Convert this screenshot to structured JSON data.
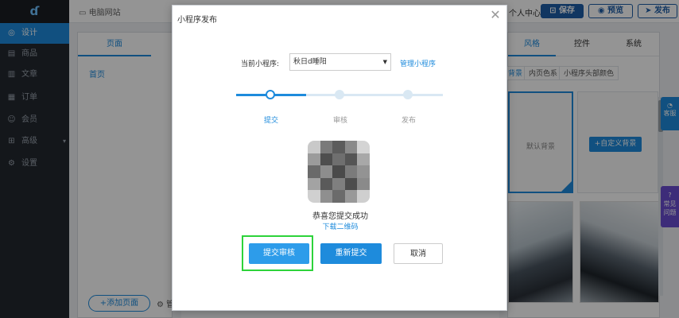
{
  "sidebar": {
    "logo": "ɗ",
    "items": [
      {
        "icon": "palette-icon",
        "glyph": "◎",
        "label": "设计",
        "active": true
      },
      {
        "icon": "shop-icon",
        "glyph": "▤",
        "label": "商品"
      },
      {
        "icon": "article-icon",
        "glyph": "▥",
        "label": "文章"
      },
      {
        "icon": "order-icon",
        "glyph": "▦",
        "label": "订单"
      },
      {
        "icon": "member-icon",
        "glyph": "☺",
        "label": "会员"
      },
      {
        "icon": "advanced-icon",
        "glyph": "⊞",
        "label": "高级",
        "arrow": "▾"
      },
      {
        "icon": "settings-icon",
        "glyph": "⚙",
        "label": "设置"
      }
    ]
  },
  "topbar": {
    "site_tab": "电脑网站",
    "user_center": "个人中心",
    "save": "保存",
    "preview": "预览",
    "publish": "发布"
  },
  "left_panel": {
    "tab": "页面",
    "home": "首页",
    "add_page": "+添加页面",
    "manage": "管"
  },
  "right_panel": {
    "tabs": [
      "风格",
      "控件",
      "系统"
    ],
    "subtabs": [
      "背景",
      "内页色系",
      "小程序头部颜色"
    ],
    "default_bg": "默认背景",
    "custom_bg": "+自定义背景"
  },
  "floating": {
    "kefu": "客服",
    "faq_1": "常见",
    "faq_2": "问题"
  },
  "modal": {
    "title": "小程序发布",
    "close": "✕",
    "current_label": "当前小程序:",
    "current_value": "秋日d睡阳",
    "manage_link": "管理小程序",
    "steps": [
      "提交",
      "审核",
      "发布"
    ],
    "success": "恭喜您提交成功",
    "download": "下载二维码",
    "buttons": {
      "submit_review": "提交审核",
      "resubmit": "重新提交",
      "cancel": "取消"
    }
  },
  "colors": {
    "accent": "#1e8bdc",
    "sidebar_bg": "#232830",
    "highlight": "#2dd33a"
  }
}
